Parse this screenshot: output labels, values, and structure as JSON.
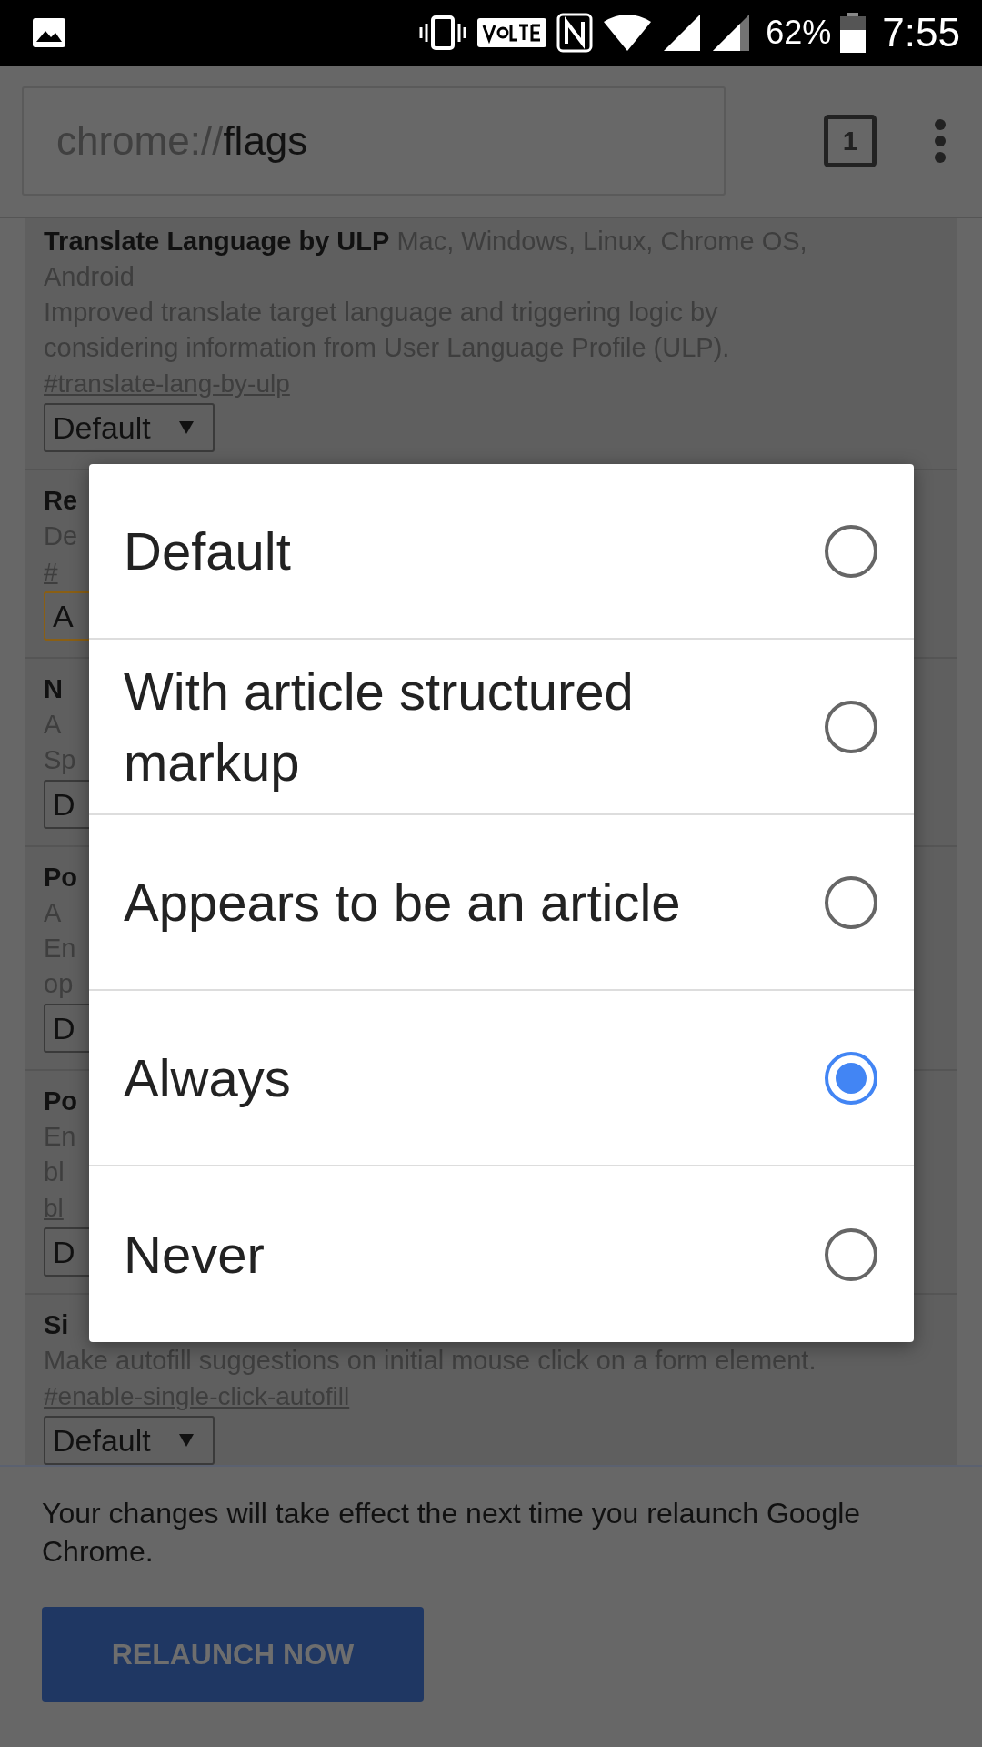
{
  "status_bar": {
    "battery": "62%",
    "time": "7:55"
  },
  "toolbar": {
    "url_scheme": "chrome://",
    "url_host": "flags",
    "tab_count": "1"
  },
  "flags": [
    {
      "heading": "**Translate Language by ULP** Mac, Windows, Linux, Chrome OS, Android",
      "lines": [
        "Improved translate target language and triggering logic by considering information from User Language Profile (ULP)."
      ],
      "link": "#translate-lang-by-ulp",
      "select": "Default",
      "focused": false
    },
    {
      "title": "Re",
      "lines": [
        "De"
      ],
      "link": "#",
      "select": "A",
      "focused": true
    },
    {
      "title": "N",
      "lines": [
        "A",
        "Sp"
      ],
      "select": "D",
      "focused": false
    },
    {
      "title": "Po",
      "lines": [
        "A",
        "En",
        "op"
      ],
      "select": "D",
      "focused": false
    },
    {
      "title": "Po",
      "lines": [
        "En",
        "bl"
      ],
      "link": "bl",
      "select": "D",
      "focused": false
    },
    {
      "title": "Si",
      "lines": [
        "Make autofill suggestions on initial mouse click on a form element."
      ],
      "link": "#enable-single-click-autofill",
      "select": "Default",
      "focused": false
    }
  ],
  "dialog": {
    "options": [
      {
        "label": "Default",
        "selected": false
      },
      {
        "label": "With article structured markup",
        "selected": false
      },
      {
        "label": "Appears to be an article",
        "selected": false
      },
      {
        "label": "Always",
        "selected": true
      },
      {
        "label": "Never",
        "selected": false
      }
    ]
  },
  "relaunch": {
    "message": "Your changes will take effect the next time you relaunch Google Chrome.",
    "button": "RELAUNCH NOW"
  }
}
